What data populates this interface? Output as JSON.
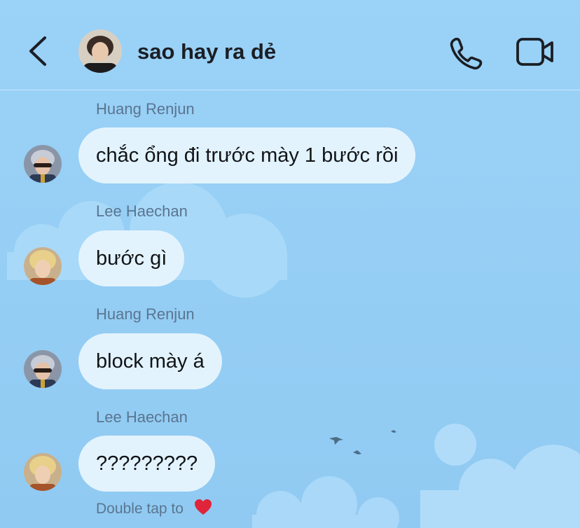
{
  "header": {
    "title": "sao hay ra dẻ",
    "back_icon": "chevron-left-icon",
    "call_icon": "phone-icon",
    "video_icon": "video-camera-icon"
  },
  "messages": [
    {
      "sender": "Huang Renjun",
      "text": "chắc ổng đi trước mày 1 bước rồi"
    },
    {
      "sender": "Lee Haechan",
      "text": "bước gì"
    },
    {
      "sender": "Huang Renjun",
      "text": "block mày á"
    },
    {
      "sender": "Lee Haechan",
      "text": "?????????"
    }
  ],
  "hint": {
    "text": "Double tap to",
    "icon": "heart-icon"
  },
  "colors": {
    "background": "#98d0f6",
    "bubble": "#e3f3fd",
    "title_text": "#1b1e24",
    "secondary_text": "#5a7590",
    "heart": "#e0243a"
  }
}
